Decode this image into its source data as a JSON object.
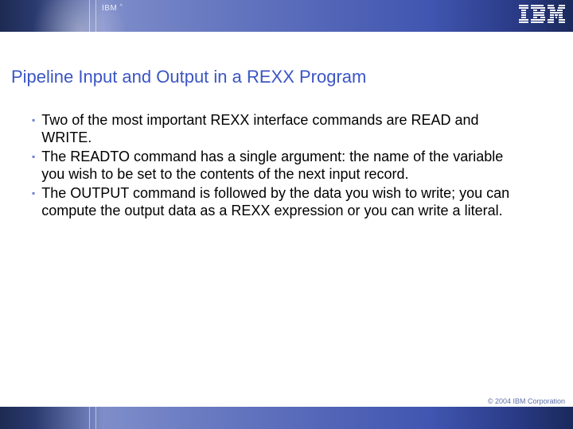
{
  "header": {
    "brand_label": "IBM",
    "brand_caret": "^"
  },
  "title": "Pipeline Input and Output in a REXX Program",
  "bullets": [
    "Two of the most important REXX interface commands are READ and WRITE.",
    "The READTO command has a single argument: the name of the variable you wish to be set to the contents of the next input record.",
    "The OUTPUT command is followed by the data you wish to write; you can compute the output data as a REXX expression or you can write a literal."
  ],
  "footer": {
    "copyright": "© 2004 IBM Corporation"
  }
}
